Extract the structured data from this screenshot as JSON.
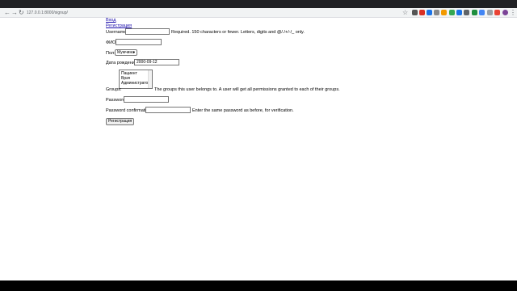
{
  "browser": {
    "url": "127.0.0.1:8000/signup/"
  },
  "nav": {
    "login": "Вход",
    "signup": "Регистрация"
  },
  "form": {
    "username_label": "Username:",
    "username_help": "Required. 150 characters or fewer. Letters, digits and @/./+/-/_ only.",
    "fio_label": "ФИО:",
    "gender_label": "Пол:",
    "gender_selected": "Мужчина",
    "birthdate_label": "Дата рождения:",
    "birthdate_value": "2000-09-12",
    "groups_label": "Groups:",
    "groups_options": [
      "Пациент",
      "Врач",
      "Администратор"
    ],
    "groups_help": "The groups this user belongs to. A user will get all permissions granted to each of their groups.",
    "password_label": "Password:",
    "password_confirm_label": "Password confirmation:",
    "password_confirm_help": "Enter the same password as before, for verification.",
    "submit_label": "Регистрация"
  }
}
